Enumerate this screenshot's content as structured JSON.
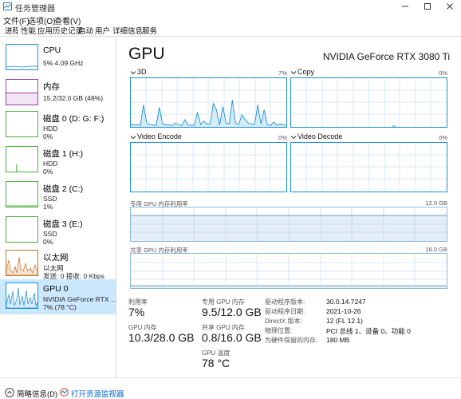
{
  "window": {
    "title": "任务管理器"
  },
  "menu": [
    "文件(F)",
    "选项(O)",
    "查看(V)"
  ],
  "tabs": [
    "进程",
    "性能",
    "应用历史记录",
    "启动",
    "用户",
    "详细信息",
    "服务"
  ],
  "resources": [
    {
      "name": "CPU",
      "line1": "5% 4.09 GHz",
      "line2": "",
      "color": "#1a8fd6"
    },
    {
      "name": "内存",
      "line1": "15.2/32.0 GB (48%)",
      "line2": "",
      "color": "#9b3fa6"
    },
    {
      "name": "磁盘 0 (D: G: F:)",
      "line1": "HDD",
      "line2": "0%",
      "color": "#4caf3f"
    },
    {
      "name": "磁盘 1 (H:)",
      "line1": "HDD",
      "line2": "0%",
      "color": "#4caf3f"
    },
    {
      "name": "磁盘 2 (C:)",
      "line1": "SSD",
      "line2": "1%",
      "color": "#4caf3f"
    },
    {
      "name": "磁盘 3 (E:)",
      "line1": "SSD",
      "line2": "0%",
      "color": "#4caf3f"
    },
    {
      "name": "以太网",
      "line1": "以太网",
      "line2": "发送: 0 接收: 0 Kbps",
      "color": "#c6752b"
    },
    {
      "name": "GPU 0",
      "line1": "NVIDIA GeForce RTX ...",
      "line2": "7% (78 °C)",
      "color": "#1a8fd6"
    }
  ],
  "gpu": {
    "title": "GPU",
    "model": "NVIDIA GeForce RTX 3080 Ti",
    "engines": [
      {
        "name": "3D",
        "pct": "7%"
      },
      {
        "name": "Copy",
        "pct": "0%"
      },
      {
        "name": "Video Encode",
        "pct": "0%"
      },
      {
        "name": "Video Decode",
        "pct": "0%"
      }
    ],
    "dedicated_label": "专用 GPU 内存利用率",
    "dedicated_max": "12.0 GB",
    "shared_label": "共享 GPU 内存利用率",
    "shared_max": "16.0 GB",
    "trace_3d": [
      6,
      4,
      5,
      3,
      45,
      8,
      5,
      4,
      3,
      40,
      6,
      5,
      4,
      3,
      8,
      5,
      3,
      15,
      4,
      3,
      3,
      30,
      5,
      12,
      6,
      6,
      48,
      35,
      4,
      42,
      8,
      6,
      55,
      8,
      5,
      25,
      15,
      8,
      6,
      5,
      45,
      6,
      35,
      5,
      3,
      10,
      4,
      6,
      5,
      3
    ]
  },
  "stats": {
    "utilization_label": "利用率",
    "utilization": "7%",
    "dedicated_mem_label": "专用 GPU 内存",
    "dedicated_mem": "9.5/12.0 GB",
    "gpu_mem_label": "GPU 内存",
    "gpu_mem": "10.3/28.0 GB",
    "shared_mem_label": "共享 GPU 内存",
    "shared_mem": "0.8/16.0 GB",
    "temp_label": "GPU 温度",
    "temp": "78 °C"
  },
  "driver": [
    {
      "label": "驱动程序版本:",
      "value": "30.0.14.7247"
    },
    {
      "label": "驱动程序日期:",
      "value": "2021-10-26"
    },
    {
      "label": "DirectX 版本:",
      "value": "12 (FL 12.1)"
    },
    {
      "label": "物理位置:",
      "value": "PCI 总线 1、设备 0、功能 0"
    },
    {
      "label": "为硬件保留的内存:",
      "value": "180 MB"
    }
  ],
  "footer": {
    "summary": "简略信息(D)",
    "monitor": "打开资源监视器"
  }
}
